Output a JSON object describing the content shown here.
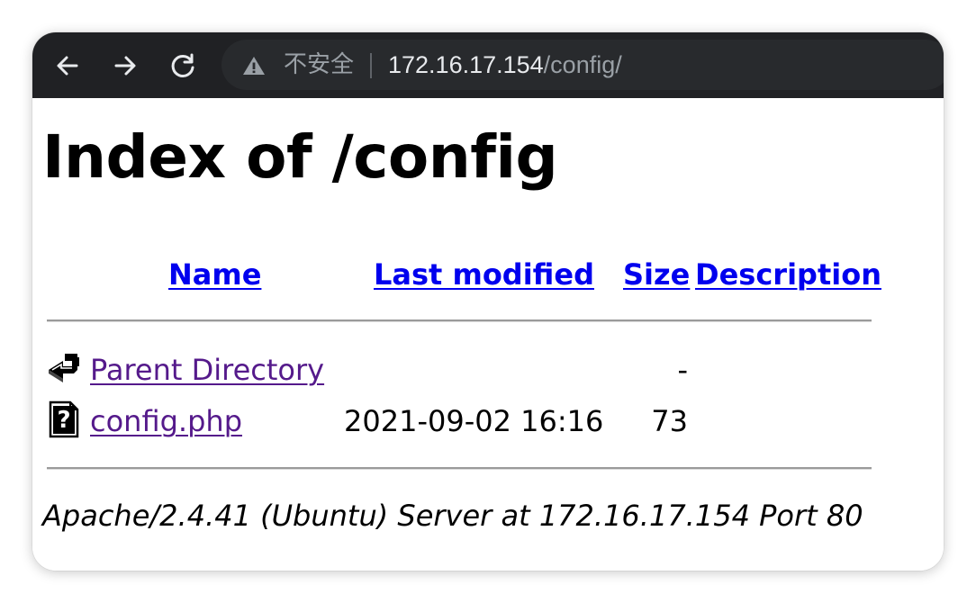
{
  "browser": {
    "security_label": "不安全",
    "url_host": "172.16.17.154",
    "url_path": "/config/",
    "icons": [
      "back-arrow-icon",
      "forward-arrow-icon",
      "reload-icon",
      "warning-icon"
    ]
  },
  "page": {
    "title": "Index of /config",
    "columns": {
      "name": "Name",
      "last_modified": "Last modified",
      "size": "Size",
      "description": "Description"
    },
    "rows": [
      {
        "icon": "back-icon",
        "name": "Parent Directory",
        "last_modified": "",
        "size": "-",
        "description": ""
      },
      {
        "icon": "unknown-file-icon",
        "name": "config.php",
        "last_modified": "2021-09-02 16:16",
        "size": "73",
        "description": ""
      }
    ],
    "address": "Apache/2.4.41 (Ubuntu) Server at 172.16.17.154 Port 80"
  },
  "colors": {
    "toolbar_bg": "#202124",
    "omnibox_bg": "#282a2d",
    "link": "#0000ee",
    "visited_link": "#551a8b"
  }
}
